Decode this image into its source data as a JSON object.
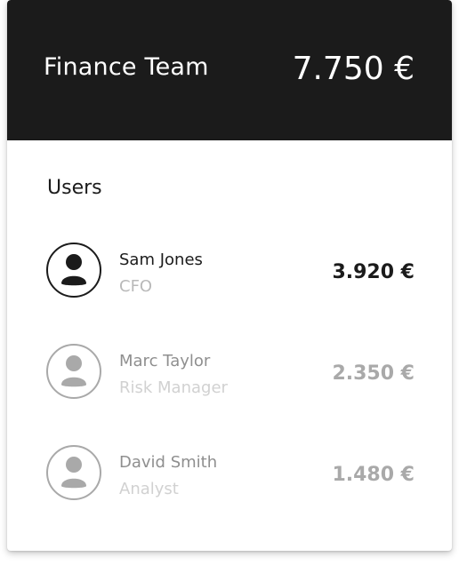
{
  "header": {
    "team_name": "Finance Team",
    "total": "7.750 €"
  },
  "users_section": {
    "title": "Users",
    "items": [
      {
        "name": "Sam Jones",
        "role": "CFO",
        "amount": "3.920 €",
        "icon": "user-icon",
        "active": true
      },
      {
        "name": "Marc Taylor",
        "role": "Risk Manager",
        "amount": "2.350 €",
        "icon": "user-icon",
        "active": false
      },
      {
        "name": "David Smith",
        "role": "Analyst",
        "amount": "1.480 €",
        "icon": "user-icon",
        "active": false
      }
    ]
  },
  "colors": {
    "header_bg": "#1b1b1b",
    "active_text": "#1b1b1b",
    "inactive_text": "#a9a9a9",
    "secondary_text": "#b9b9b9"
  }
}
